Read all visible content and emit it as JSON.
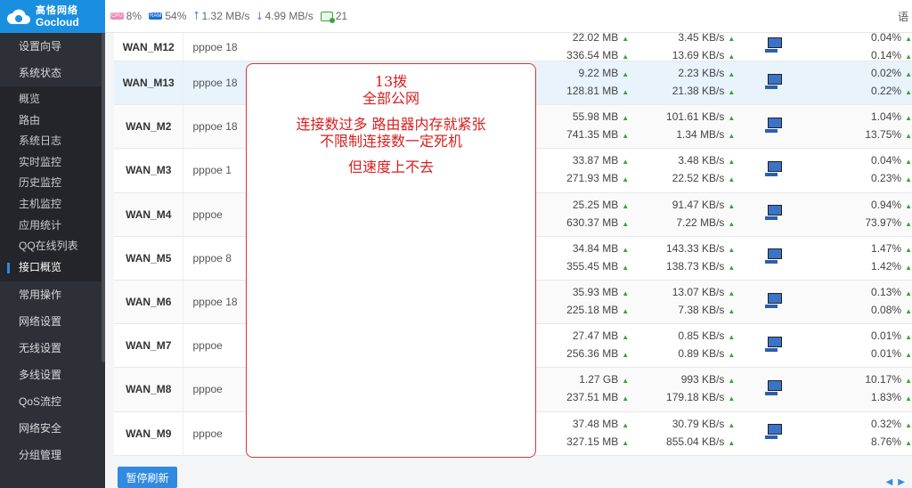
{
  "brand": {
    "cn": "高恪网络",
    "en": "Gocloud"
  },
  "status": {
    "cpu_label": "CPU",
    "cpu": "8%",
    "ram_label": "RAM",
    "ram": "54%",
    "up_arrow": "⭡",
    "upload": "1.32 MB/s",
    "down_arrow": "⭣",
    "download": "4.99 MB/s",
    "devices": "21",
    "lang": "语"
  },
  "sidebar": {
    "items_top": [
      {
        "label": "设置向导"
      },
      {
        "label": "系统状态"
      }
    ],
    "sub_items": [
      {
        "label": "概览"
      },
      {
        "label": "路由"
      },
      {
        "label": "系统日志"
      },
      {
        "label": "实时监控"
      },
      {
        "label": "历史监控"
      },
      {
        "label": "主机监控"
      },
      {
        "label": "应用统计"
      },
      {
        "label": "QQ在线列表"
      },
      {
        "label": "接口概览"
      }
    ],
    "items_bottom": [
      {
        "label": "常用操作"
      },
      {
        "label": "网络设置"
      },
      {
        "label": "无线设置"
      },
      {
        "label": "多线设置"
      },
      {
        "label": "QoS流控"
      },
      {
        "label": "网络安全"
      },
      {
        "label": "分组管理"
      }
    ]
  },
  "table": {
    "rows": [
      {
        "name": "WAN_M12",
        "type": "pppoe",
        "t2": "18",
        "f1": "22.02 MB",
        "f2": "336.54 MB",
        "r1": "3.45 KB/s",
        "r2": "13.69 KB/s",
        "p1": "0.04%",
        "p2": "0.14%"
      },
      {
        "name": "WAN_M13",
        "type": "pppoe",
        "t2": "18",
        "f1": "9.22 MB",
        "f2": "128.81 MB",
        "r1": "2.23 KB/s",
        "r2": "21.38 KB/s",
        "p1": "0.02%",
        "p2": "0.22%"
      },
      {
        "name": "WAN_M2",
        "type": "pppoe",
        "t2": "18",
        "f1": "55.98 MB",
        "f2": "741.35 MB",
        "r1": "101.61 KB/s",
        "r2": "1.34 MB/s",
        "p1": "1.04%",
        "p2": "13.75%"
      },
      {
        "name": "WAN_M3",
        "type": "pppoe",
        "t2": "1",
        "f1": "33.87 MB",
        "f2": "271.93 MB",
        "r1": "3.48 KB/s",
        "r2": "22.52 KB/s",
        "p1": "0.04%",
        "p2": "0.23%"
      },
      {
        "name": "WAN_M4",
        "type": "pppoe",
        "t2": "",
        "f1": "25.25 MB",
        "f2": "630.37 MB",
        "r1": "91.47 KB/s",
        "r2": "7.22 MB/s",
        "p1": "0.94%",
        "p2": "73.97%"
      },
      {
        "name": "WAN_M5",
        "type": "pppoe",
        "t2": "8",
        "f1": "34.84 MB",
        "f2": "355.45 MB",
        "r1": "143.33 KB/s",
        "r2": "138.73 KB/s",
        "p1": "1.47%",
        "p2": "1.42%"
      },
      {
        "name": "WAN_M6",
        "type": "pppoe",
        "t2": "18",
        "f1": "35.93 MB",
        "f2": "225.18 MB",
        "r1": "13.07 KB/s",
        "r2": "7.38 KB/s",
        "p1": "0.13%",
        "p2": "0.08%"
      },
      {
        "name": "WAN_M7",
        "type": "pppoe",
        "t2": "",
        "f1": "27.47 MB",
        "f2": "256.36 MB",
        "r1": "0.85 KB/s",
        "r2": "0.89 KB/s",
        "p1": "0.01%",
        "p2": "0.01%"
      },
      {
        "name": "WAN_M8",
        "type": "pppoe",
        "t2": "",
        "f1": "1.27 GB",
        "f2": "237.51 MB",
        "r1": "993 KB/s",
        "r2": "179.18 KB/s",
        "p1": "10.17%",
        "p2": "1.83%"
      },
      {
        "name": "WAN_M9",
        "type": "pppoe",
        "t2": "",
        "f1": "37.48 MB",
        "f2": "327.15 MB",
        "r1": "30.79 KB/s",
        "r2": "855.04 KB/s",
        "p1": "0.32%",
        "p2": "8.76%"
      }
    ],
    "up_glyph": "▲"
  },
  "note": {
    "line1": "13拨",
    "line2": "全部公网",
    "line3": "连接数过多 路由器内存就紧张",
    "line4": "不限制连接数一定死机",
    "line5": "但速度上不去"
  },
  "footer": {
    "pause_label": "暂停刷新",
    "prev": "◀",
    "next": "▶"
  }
}
